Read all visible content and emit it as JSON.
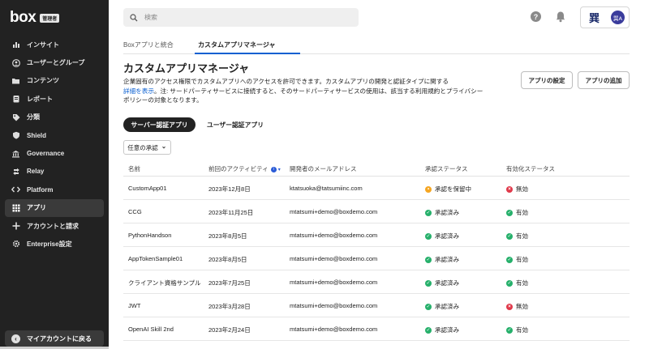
{
  "sidebar": {
    "logo": "box",
    "admin_badge": "管理者",
    "items": [
      {
        "label": "インサイト",
        "icon": "bar-chart-icon"
      },
      {
        "label": "ユーザーとグループ",
        "icon": "user-icon"
      },
      {
        "label": "コンテンツ",
        "icon": "folder-icon"
      },
      {
        "label": "レポート",
        "icon": "report-icon"
      },
      {
        "label": "分類",
        "icon": "tag-icon"
      },
      {
        "label": "Shield",
        "icon": "shield-icon"
      },
      {
        "label": "Governance",
        "icon": "governance-icon"
      },
      {
        "label": "Relay",
        "icon": "relay-icon"
      },
      {
        "label": "Platform",
        "icon": "platform-icon"
      },
      {
        "label": "アプリ",
        "icon": "apps-icon",
        "active": true
      },
      {
        "label": "アカウントと請求",
        "icon": "billing-icon"
      },
      {
        "label": "Enterprise設定",
        "icon": "gear-icon"
      }
    ],
    "my_account": "マイアカウントに戻る"
  },
  "header": {
    "search_placeholder": "検索",
    "account_kanji": "巽",
    "avatar_initials": "巽A"
  },
  "tabs": [
    {
      "label": "Boxアプリと統合",
      "active": false
    },
    {
      "label": "カスタムアプリマネージャ",
      "active": true
    }
  ],
  "page": {
    "title": "カスタムアプリマネージャ",
    "description_1": "企業固有のアクセス権限でカスタムアプリへのアクセスを許可できます。カスタムアプリの開発と認証タイプに関する",
    "description_link": "詳細を表示",
    "description_2": "。注: サードパーティサービスに接続すると、そのサードパーティサービスの使用は、該当する利用規約とプライバシー",
    "description_3": "ポリシーの対象となります。",
    "settings_button": "アプリの設定",
    "add_button": "アプリの追加"
  },
  "toggle": {
    "server_auth": "サーバー認証アプリ",
    "user_auth": "ユーザー認証アプリ"
  },
  "filter": {
    "label": "任意の承認"
  },
  "table": {
    "headers": {
      "name": "名前",
      "last_activity": "前回のアクティビティ",
      "dev_email": "開発者のメールアドレス",
      "approval_status": "承認ステータス",
      "enable_status": "有効化ステータス"
    },
    "rows": [
      {
        "name": "CustomApp01",
        "date": "2023年12月8日",
        "email": "ktatsuoka@tatsumiinc.com",
        "approval": "承認を保留中",
        "approval_kind": "pending",
        "enabled": "無効",
        "enabled_kind": "disabled"
      },
      {
        "name": "CCG",
        "date": "2023年11月25日",
        "email": "mtatsumi+demo@boxdemo.com",
        "approval": "承認済み",
        "approval_kind": "ok",
        "enabled": "有効",
        "enabled_kind": "enabled"
      },
      {
        "name": "PythonHandson",
        "date": "2023年8月5日",
        "email": "mtatsumi+demo@boxdemo.com",
        "approval": "承認済み",
        "approval_kind": "ok",
        "enabled": "有効",
        "enabled_kind": "enabled"
      },
      {
        "name": "AppTokenSample01",
        "date": "2023年8月5日",
        "email": "mtatsumi+demo@boxdemo.com",
        "approval": "承認済み",
        "approval_kind": "ok",
        "enabled": "有効",
        "enabled_kind": "enabled"
      },
      {
        "name": "クライアント資格サンプル",
        "date": "2023年7月25日",
        "email": "mtatsumi+demo@boxdemo.com",
        "approval": "承認済み",
        "approval_kind": "ok",
        "enabled": "有効",
        "enabled_kind": "enabled"
      },
      {
        "name": "JWT",
        "date": "2023年3月28日",
        "email": "mtatsumi+demo@boxdemo.com",
        "approval": "承認済み",
        "approval_kind": "ok",
        "enabled": "無効",
        "enabled_kind": "disabled"
      },
      {
        "name": "OpenAI Skill 2nd",
        "date": "2023年2月24日",
        "email": "mtatsumi+demo@boxdemo.com",
        "approval": "承認済み",
        "approval_kind": "ok",
        "enabled": "有効",
        "enabled_kind": "enabled"
      }
    ]
  },
  "colors": {
    "sidebar_bg": "#222222",
    "accent": "#0a5fd1",
    "ok": "#26b06b",
    "pending": "#f5a623",
    "disabled": "#e0394a"
  }
}
